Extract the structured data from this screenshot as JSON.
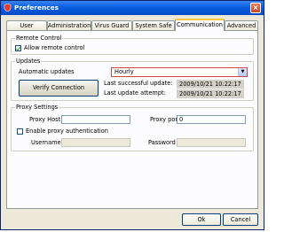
{
  "window": {
    "title": "Preferences",
    "close_glyph": "×"
  },
  "tabs": [
    {
      "label": "User Interface"
    },
    {
      "label": "Administration"
    },
    {
      "label": "Virus Guard"
    },
    {
      "label": "System Safe"
    },
    {
      "label": "Communication",
      "active": true
    },
    {
      "label": "Advanced"
    }
  ],
  "remote_control": {
    "group_label": "Remote Control",
    "allow_label": "Allow remote control",
    "allow_checked": true
  },
  "updates": {
    "group_label": "Updates",
    "auto_label": "Automatic updates",
    "frequency_value": "Hourly",
    "verify_button": "Verify Connection",
    "last_success_label": "Last successful update:",
    "last_success_value": "2009/10/21 10:22:17",
    "last_attempt_label": "Last update attempt:",
    "last_attempt_value": "2009/10/21 10:22:17"
  },
  "proxy": {
    "group_label": "Proxy Settings",
    "host_label": "Proxy Host:",
    "host_value": "",
    "port_label": "Proxy port",
    "port_value": "0",
    "auth_label": "Enable proxy authentication",
    "auth_checked": false,
    "username_label": "Username",
    "username_value": "",
    "password_label": "Password",
    "password_value": ""
  },
  "footer": {
    "ok_label": "Ok",
    "cancel_label": "Cancel"
  },
  "icons": {
    "app": "shield-icon",
    "dropdown": "chevron-down-icon"
  },
  "colors": {
    "titlebar": "#0a5fe0",
    "active_tab_accent": "#ffc83c",
    "select_border": "#d04545"
  }
}
